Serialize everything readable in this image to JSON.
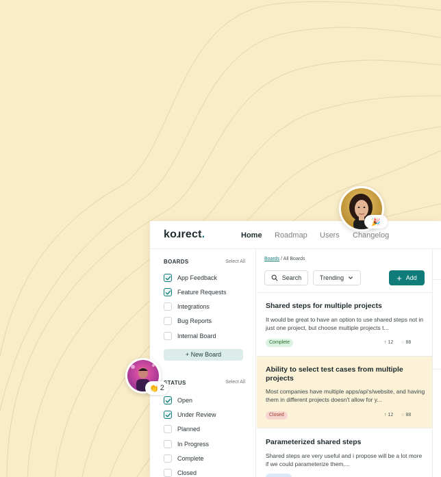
{
  "app": {
    "logo": "korrect",
    "logo_display": "koɹrect",
    "logo_dot": ".",
    "nav": [
      "Home",
      "Roadmap",
      "Users",
      "Changelog"
    ]
  },
  "sidebar": {
    "boards_title": "BOARDS",
    "boards_select_all": "Select All",
    "boards": [
      {
        "label": "App Feedback",
        "checked": true
      },
      {
        "label": "Feature Requests",
        "checked": true
      },
      {
        "label": "Integrations",
        "checked": false
      },
      {
        "label": "Bug Reports",
        "checked": false
      },
      {
        "label": "Internal Board",
        "checked": false
      }
    ],
    "new_board": "+ New Board",
    "status_title": "STATUS",
    "status_select_all": "Select All",
    "statuses": [
      {
        "label": "Open",
        "checked": true
      },
      {
        "label": "Under Review",
        "checked": true
      },
      {
        "label": "Planned",
        "checked": false
      },
      {
        "label": "In Progress",
        "checked": false
      },
      {
        "label": "Complete",
        "checked": false
      },
      {
        "label": "Closed",
        "checked": false
      }
    ]
  },
  "main": {
    "breadcrumb_link": "Boards",
    "breadcrumb_sep": "/",
    "breadcrumb_current": "All Boards",
    "search_label": "Search",
    "sort_label": "Trending",
    "add_label": "Add",
    "posts": [
      {
        "title": "Shared steps for multiple projects",
        "description": "It would be great to have an option to use shared steps not in just one project, but choose multiple projects t...",
        "status": "Complete",
        "upvotes": "12",
        "comments": "88"
      },
      {
        "title": "Ability to select test cases from multiple projects",
        "description": "Most companies have multiple apps/api's/website, and having them in different projects doesn't allow for y...",
        "status": "Closed",
        "upvotes": "12",
        "comments": "88"
      },
      {
        "title": "Parameterized shared steps",
        "description": "Shared steps are very useful and i propose will be a lot more if we could parameterize them....",
        "status": "",
        "upvotes": "",
        "comments": ""
      }
    ]
  },
  "reactions": {
    "clap_count": "2",
    "clap_icon": "clapping-hands-icon",
    "party_icon": "party-popper-icon"
  },
  "colors": {
    "background": "#f9edc8",
    "accent": "#0f7c7a",
    "highlight_card": "#fbf2d7"
  }
}
